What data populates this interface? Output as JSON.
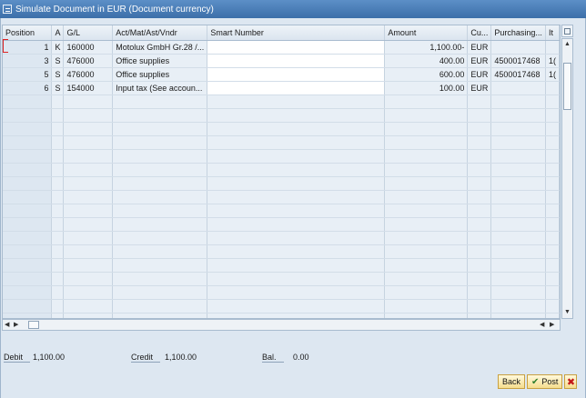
{
  "window": {
    "title": "Simulate Document in EUR (Document currency)"
  },
  "table": {
    "columns": [
      "Position",
      "A",
      "G/L",
      "Act/Mat/Ast/Vndr",
      "Smart Number",
      "Amount",
      "Cu...",
      "Purchasing...",
      "It"
    ],
    "rows": [
      {
        "position": "1",
        "a": "K",
        "gl": "160000",
        "account": "Motolux GmbH Gr.28 /...",
        "smart": "",
        "amount": "1,100.00-",
        "currency": "EUR",
        "purchasing": "",
        "item": ""
      },
      {
        "position": "3",
        "a": "S",
        "gl": "476000",
        "account": "Office supplies",
        "smart": "",
        "amount": "400.00",
        "currency": "EUR",
        "purchasing": "4500017468",
        "item": "1("
      },
      {
        "position": "5",
        "a": "S",
        "gl": "476000",
        "account": "Office supplies",
        "smart": "",
        "amount": "600.00",
        "currency": "EUR",
        "purchasing": "4500017468",
        "item": "1("
      },
      {
        "position": "6",
        "a": "S",
        "gl": "154000",
        "account": "Input tax (See accoun...",
        "smart": "",
        "amount": "100.00",
        "currency": "EUR",
        "purchasing": "",
        "item": ""
      }
    ]
  },
  "totals": {
    "debit_label": "Debit",
    "debit_value": "1,100.00",
    "credit_label": "Credit",
    "credit_value": "1,100.00",
    "balance_label": "Bal.",
    "balance_value": "0.00"
  },
  "buttons": {
    "back": "Back",
    "post": "Post",
    "close": "✖"
  },
  "icons": {
    "post": "checkmark-icon",
    "close": "close-icon",
    "title": "document-icon"
  },
  "colors": {
    "title_bar": "#4a7fbb",
    "button_border": "#c8a040",
    "close_red": "#c21818"
  }
}
